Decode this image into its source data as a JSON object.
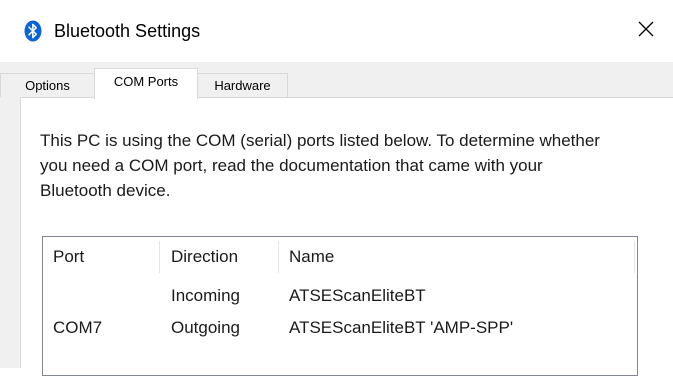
{
  "window": {
    "title": "Bluetooth Settings",
    "icon": "bluetooth-icon",
    "close_icon": "close-icon",
    "accent_color": "#0a64d8"
  },
  "tabs": [
    {
      "label": "Options",
      "selected": false
    },
    {
      "label": "COM Ports",
      "selected": true
    },
    {
      "label": "Hardware",
      "selected": false
    }
  ],
  "com_ports": {
    "description": "This PC is using the COM (serial) ports listed below. To determine whether you need a COM port, read the documentation that came with your Bluetooth device.",
    "columns": [
      "Port",
      "Direction",
      "Name"
    ],
    "rows": [
      {
        "port": "",
        "direction": "Incoming",
        "name": "ATSEScanEliteBT"
      },
      {
        "port": "COM7",
        "direction": "Outgoing",
        "name": "ATSEScanEliteBT 'AMP-SPP'"
      }
    ]
  }
}
